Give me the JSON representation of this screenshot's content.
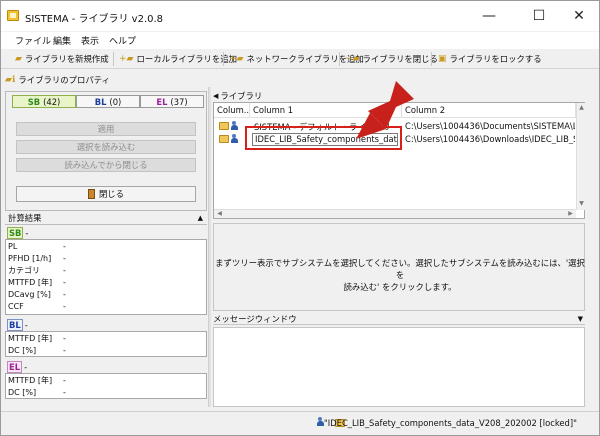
{
  "window": {
    "title": "SISTEMA - ライブラリ v2.0.8",
    "minimize": "—",
    "maximize": "☐",
    "close": "✕"
  },
  "menu": [
    "ファイル",
    "編集",
    "表示",
    "ヘルプ"
  ],
  "toolbar": {
    "new_library": "ライブラリを新規作成",
    "add_local": "ローカルライブラリを追加",
    "add_network": "ネットワークライブラリを追加",
    "close_library": "ライブラリを閉じる",
    "lock_library": "ライブラリをロックする"
  },
  "properties": {
    "header": "ライブラリのプロパティ",
    "chips": [
      {
        "tag": "SB",
        "count": "(42)",
        "color": "#2e8b1e"
      },
      {
        "tag": "BL",
        "count": "(0)",
        "color": "#1a3fa0"
      },
      {
        "tag": "EL",
        "count": "(37)",
        "color": "#a0209a"
      }
    ],
    "apply": "適用",
    "load_selection": "選択を読み込む",
    "load_and_close": "読み込んでから閉じる",
    "close": "閉じる"
  },
  "calc": {
    "header": "計算結果",
    "sb_tag": "SB",
    "bl_tag": "BL",
    "el_tag": "EL",
    "dash": "-",
    "sb_rows": [
      {
        "label": "PL",
        "value": "-"
      },
      {
        "label": "PFHD [1/h]",
        "value": "-"
      },
      {
        "label": "カテゴリ",
        "value": "-"
      },
      {
        "label": "MTTFD [年]",
        "value": "-"
      },
      {
        "label": "DCavg [%]",
        "value": "-"
      },
      {
        "label": "CCF",
        "value": "-"
      }
    ],
    "bl_rows": [
      {
        "label": "MTTFD [年]",
        "value": "-"
      },
      {
        "label": "DC [%]",
        "value": "-"
      }
    ],
    "el_rows": [
      {
        "label": "MTTFD [年]",
        "value": "-"
      },
      {
        "label": "DC [%]",
        "value": "-"
      }
    ]
  },
  "library": {
    "title": "ライブラリ",
    "columns": [
      "Colum...",
      "Column 1",
      "Column 2"
    ],
    "rows": [
      {
        "name": "SISTEMA - デフォルト・ライブラリー",
        "path": "C:\\Users\\1004436\\Documents\\SISTEMA\\Libr..."
      },
      {
        "name": "IDEC_LIB_Safety_components_data...",
        "path": "C:\\Users\\1004436\\Downloads\\IDEC_LIB_Saf..."
      }
    ]
  },
  "hint": {
    "line1": "まずツリー表示でサブシステムを選択してください。選択したサブシステムを読み込むには、'選択を",
    "line2": "読み込む' をクリックします。"
  },
  "messages": {
    "title": "メッセージウィンドウ"
  },
  "status": {
    "text": "\"IDEC_LIB_Safety_components_data_V208_202002 [locked]\""
  },
  "colors": {
    "highlight": "#d8201b",
    "arrow": "#c8201a"
  }
}
